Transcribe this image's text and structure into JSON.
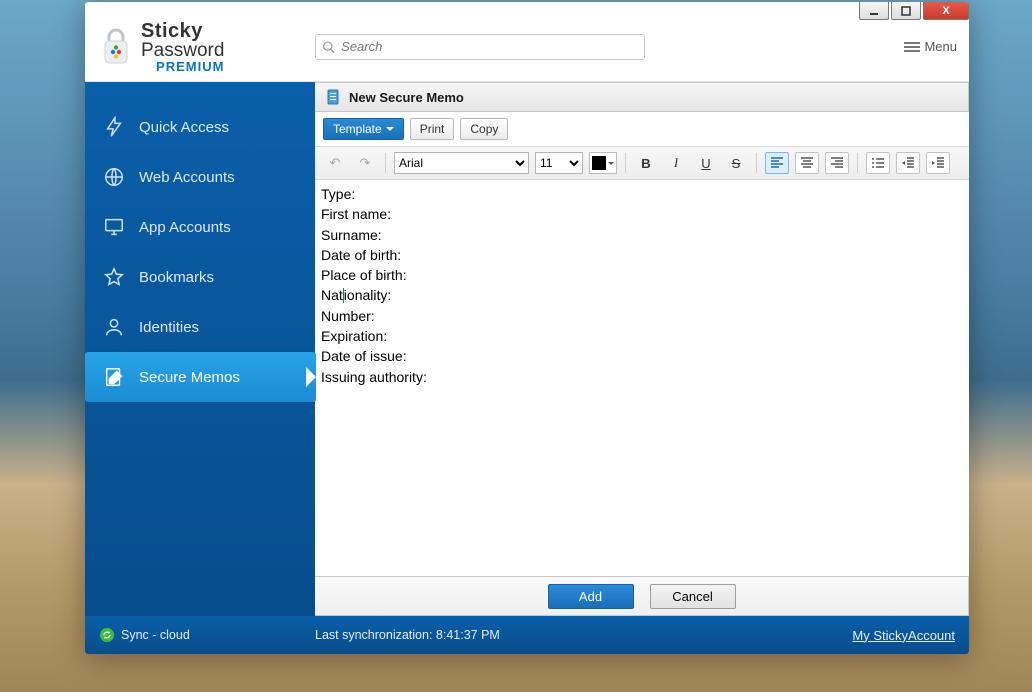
{
  "app": {
    "brand_line1": "Sticky",
    "brand_line2": "Password",
    "brand_edition": "PREMIUM"
  },
  "search": {
    "placeholder": "Search"
  },
  "menu_label": "Menu",
  "sidebar": {
    "items": [
      {
        "label": "Quick Access",
        "icon": "bolt-icon"
      },
      {
        "label": "Web Accounts",
        "icon": "globe-icon"
      },
      {
        "label": "App Accounts",
        "icon": "monitor-icon"
      },
      {
        "label": "Bookmarks",
        "icon": "star-icon"
      },
      {
        "label": "Identities",
        "icon": "person-icon"
      },
      {
        "label": "Secure Memos",
        "icon": "note-edit-icon"
      }
    ],
    "active_index": 5
  },
  "pane": {
    "title": "New Secure Memo",
    "toolbar": {
      "template_label": "Template",
      "print_label": "Print",
      "copy_label": "Copy"
    },
    "format": {
      "font_family": "Arial",
      "font_size": "11",
      "color": "#000000"
    },
    "content_lines": [
      "Type:",
      "First name:",
      "Surname:",
      "Date of birth:",
      "Place of birth:",
      "Nationality:",
      "Number:",
      "Expiration:",
      "Date of issue:",
      "Issuing authority:"
    ],
    "actions": {
      "add_label": "Add",
      "cancel_label": "Cancel"
    }
  },
  "status": {
    "sync_label": "Sync - cloud",
    "last_sync": "Last synchronization: 8:41:37 PM",
    "account_link": "My StickyAccount"
  }
}
